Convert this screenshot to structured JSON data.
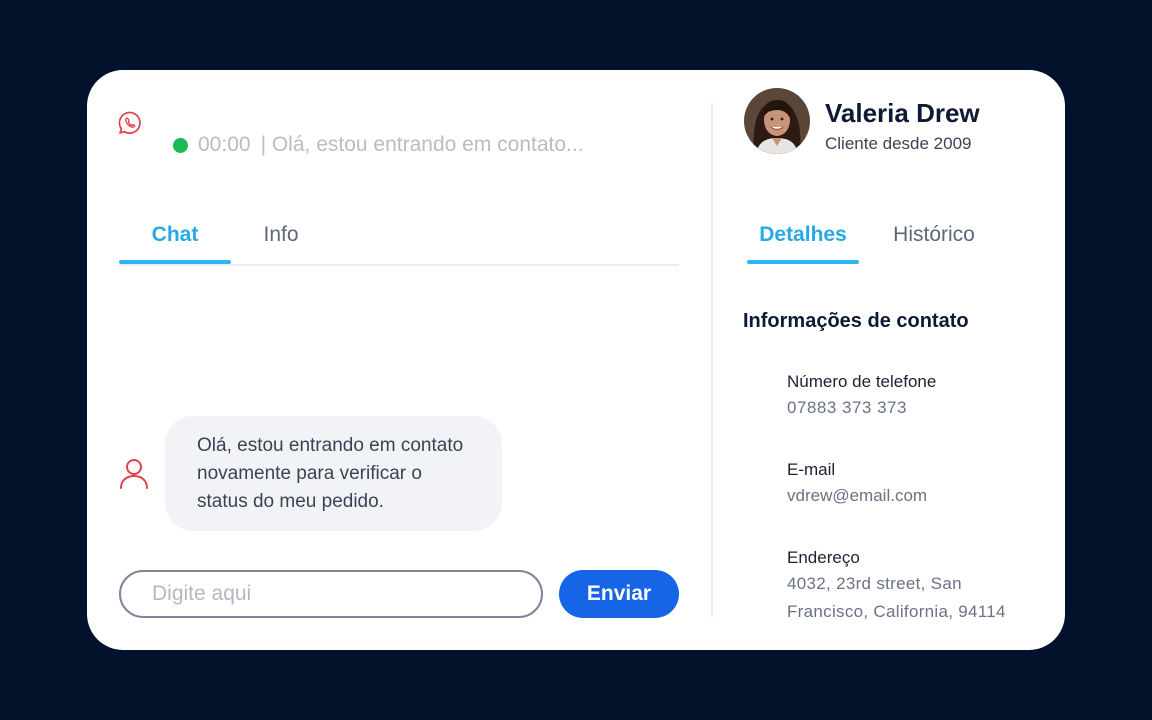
{
  "chat_panel": {
    "status_time": "00:00",
    "status_preview": "| Olá, estou entrando em contato...",
    "tabs": [
      {
        "label": "Chat",
        "active": true
      },
      {
        "label": "Info",
        "active": false
      }
    ],
    "message": {
      "lines": [
        "Olá, estou entrando em contato",
        "novamente para verificar o",
        "status do meu pedido."
      ]
    },
    "composer": {
      "placeholder": "Digite aqui",
      "value": "",
      "send_label": "Enviar"
    }
  },
  "customer_panel": {
    "name": "Valeria Drew",
    "subtitle": "Cliente desde 2009",
    "tabs": [
      {
        "label": "Detalhes",
        "active": true
      },
      {
        "label": "Histórico",
        "active": false
      }
    ],
    "section_title": "Informações de contato",
    "fields": [
      {
        "label": "Número de telefone",
        "value_lines": [
          "07883 373 373"
        ]
      },
      {
        "label": "E-mail",
        "value_lines": [
          "vdrew@email.com"
        ]
      },
      {
        "label": "Endereço",
        "value_lines": [
          "4032, 23rd street, San",
          "Francisco, California, 94114"
        ]
      }
    ]
  },
  "icons": {
    "channel": "whatsapp-icon",
    "sender": "user-icon",
    "status": "online-status-dot"
  },
  "colors": {
    "background": "#03112a",
    "accent": "#2cb6f0",
    "primary_button": "#1565e6",
    "online": "#1db954",
    "icon_red": "#e0404b"
  }
}
